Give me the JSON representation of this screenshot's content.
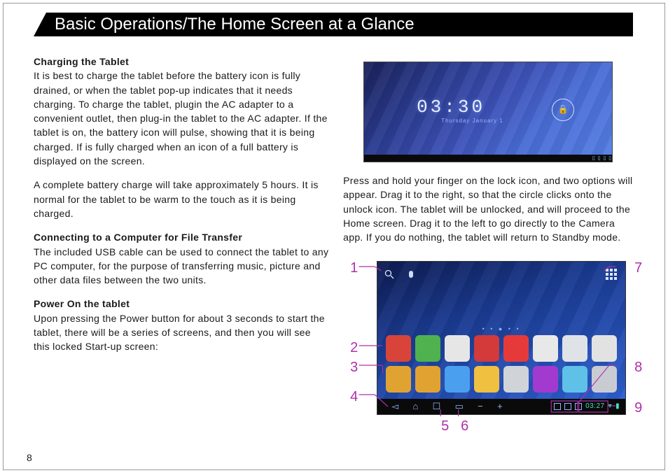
{
  "title": "Basic Operations/The Home Screen at a Glance",
  "page_number": "8",
  "left": {
    "h1": "Charging the Tablet",
    "p1": "It is best to charge the tablet before the battery icon is fully drained, or when the tablet pop-up indicates that it needs charging. To charge the tablet, plugin the AC adapter to a convenient outlet, then plug-in the tablet to the AC adapter. If the tablet is on, the battery icon will pulse, showing that it is being charged. If is fully charged when an icon of a full battery is displayed on the screen.",
    "p2": "A complete battery charge will take approximately 5 hours. It is normal for the tablet to be warm to the touch as it is being charged.",
    "h2": "Connecting to a Computer for File Transfer",
    "p3": "The included USB cable can be used to connect the tablet to any PC computer, for the purpose of transferring music, picture and other data files between the two units.",
    "h3": "Power On the tablet",
    "p4": "Upon pressing the Power button for about 3 seconds to start the tablet, there will be a series of screens, and then you will see this locked Start-up screen:"
  },
  "right": {
    "p1": "Press and hold your finger on the lock icon, and two options will appear. Drag it to the right, so that the circle clicks onto the unlock icon. The tablet will be unlocked, and will proceed to the Home screen. Drag it to the left to go directly to the Camera app. If you do nothing, the tablet will return to Standby mode."
  },
  "lock_screen": {
    "time": "03:30",
    "date_sub": "Thursday\nJanuary 1",
    "lock_glyph": "🔒"
  },
  "home_screen": {
    "status_time": "03:27",
    "apps_row1_colors": [
      "#d9443a",
      "#4fb24e",
      "#e6e6e6",
      "#d33a3a",
      "#e63a3a",
      "#e8e8e8",
      "#dfe3e8",
      "#e2e2e2"
    ],
    "apps_row2_colors": [
      "#e0a332",
      "#e0a332",
      "#4aa0ee",
      "#f0c040",
      "#d0d4d8",
      "#a23ad0",
      "#5fc0e8",
      "#c8ccd2"
    ]
  },
  "callouts": {
    "n1": "1",
    "n2": "2",
    "n3": "3",
    "n4": "4",
    "n5": "5",
    "n6": "6",
    "n7": "7",
    "n8": "8",
    "n9": "9"
  }
}
